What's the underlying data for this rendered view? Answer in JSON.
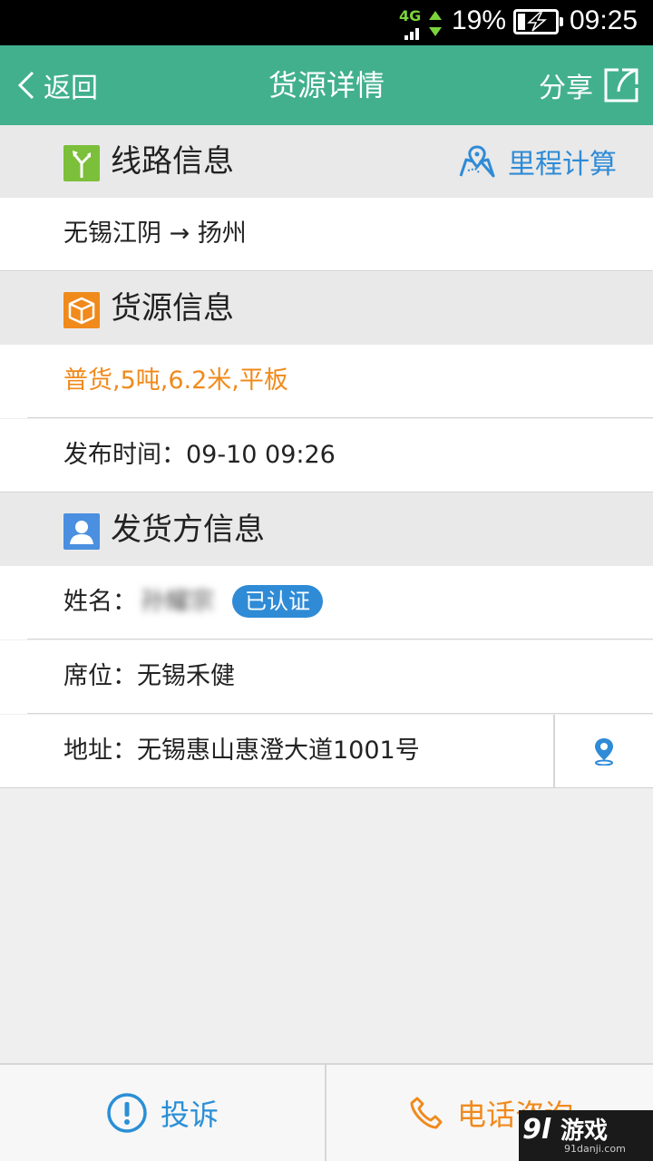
{
  "status_bar": {
    "network": "4G",
    "battery_percent": "19%",
    "battery_level": 0.19,
    "time": "09:25"
  },
  "header": {
    "back_label": "返回",
    "title": "货源详情",
    "share_label": "分享"
  },
  "route_section": {
    "title": "线路信息",
    "mileage_label": "里程计算",
    "route_text": "无锡江阴 → 扬州"
  },
  "cargo_section": {
    "title": "货源信息",
    "cargo_desc": "普货,5吨,6.2米,平板",
    "publish_time": "发布时间：09-10 09:26"
  },
  "shipper_section": {
    "title": "发货方信息",
    "name_label": "姓名：",
    "name_value": "孙耀宗",
    "verified_badge": "已认证",
    "seat": "席位：无锡禾健",
    "address": "地址：无锡惠山惠澄大道1001号"
  },
  "bottom_bar": {
    "complaint_label": "投诉",
    "call_label": "电话咨询"
  },
  "watermark": {
    "logo": "9l",
    "text": "游戏",
    "sub": "91danji.com"
  },
  "colors": {
    "header_bg": "#42b08d",
    "accent_blue": "#2f8bd6",
    "accent_orange": "#f08a1c"
  }
}
